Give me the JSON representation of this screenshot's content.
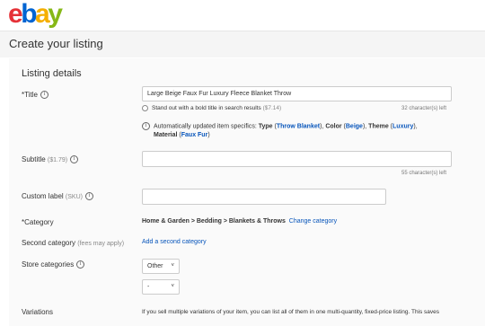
{
  "logo": {
    "e": "e",
    "b": "b",
    "a": "a",
    "y": "y"
  },
  "page_title": "Create your listing",
  "section_title": "Listing details",
  "title_field": {
    "label": "*Title",
    "value": "Large Beige Faux Fur Luxury Fleece Blanket Throw",
    "bold_title_option": "Stand out with a bold title in search results",
    "bold_title_price": "($7.14)",
    "chars_left": "32 character(s) left"
  },
  "specifics": {
    "prefix": "Automatically updated item specifics:",
    "type_label": "Type",
    "type_value": "Throw Blanket",
    "color_label": "Color",
    "color_value": "Beige",
    "theme_label": "Theme",
    "theme_value": "Luxury",
    "material_label": "Material",
    "material_value": "Faux Fur"
  },
  "subtitle_field": {
    "label": "Subtitle",
    "price": "($1.79)",
    "value": "",
    "chars_left": "55 character(s) left"
  },
  "custom_label_field": {
    "label": "Custom label",
    "hint": "(SKU)",
    "value": ""
  },
  "category": {
    "label": "*Category",
    "path": "Home & Garden > Bedding > Blankets & Throws",
    "change_link": "Change category"
  },
  "second_category": {
    "label": "Second category",
    "hint": "(fees may apply)",
    "add_link": "Add a second category"
  },
  "store_categories": {
    "label": "Store categories",
    "select1": "Other",
    "select2": "-"
  },
  "variations": {
    "label": "Variations",
    "text": "If you sell multiple variations of your item, you can list all of them in one multi-quantity, fixed-price listing. This saves"
  },
  "icons": {
    "info": "i",
    "chevron": "˅"
  }
}
